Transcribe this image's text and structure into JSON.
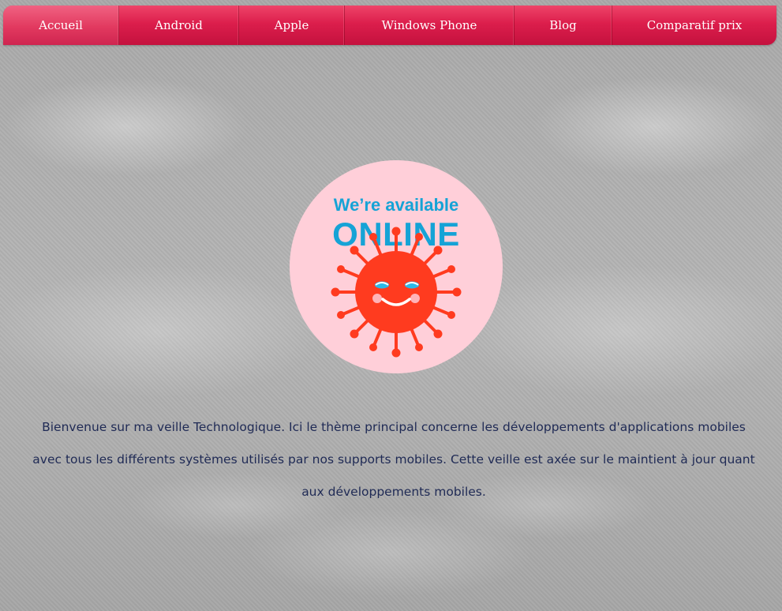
{
  "nav": {
    "items": [
      {
        "label": "Accueil",
        "active": true
      },
      {
        "label": "Android",
        "active": false
      },
      {
        "label": "Apple",
        "active": false
      },
      {
        "label": "Windows Phone",
        "active": false
      },
      {
        "label": "Blog",
        "active": false
      },
      {
        "label": "Comparatif prix",
        "active": false
      }
    ]
  },
  "badge": {
    "line1": "We’re available",
    "line2": "ONLINE",
    "icon": "smiling-virus-icon"
  },
  "intro": {
    "text": "Bienvenue sur ma veille Technologique. Ici le thème principal concerne les développements d'applications mobiles avec tous les différents systèmes utilisés par nos supports mobiles. Cette veille est axée sur le maintient à jour quant aux développements mobiles."
  },
  "colors": {
    "nav": "#dc1e4c",
    "badge_bg": "#ffcfd9",
    "badge_text": "#15a3d6",
    "virus": "#ff3b1f",
    "intro_text": "#1f2a55"
  }
}
